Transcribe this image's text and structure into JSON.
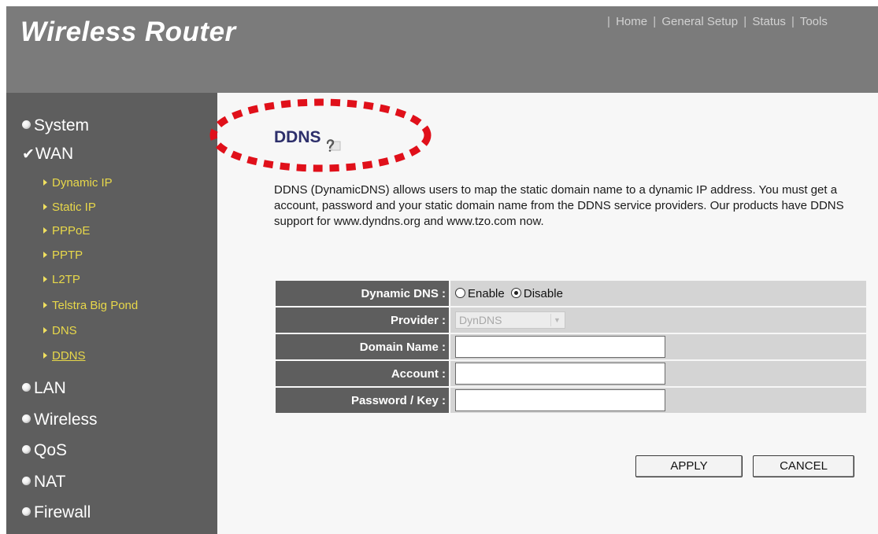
{
  "header": {
    "brand": "Wireless Router",
    "nav": [
      "Home",
      "General Setup",
      "Status",
      "Tools"
    ]
  },
  "sidebar": {
    "main_items": [
      "System",
      "WAN",
      "LAN",
      "Wireless",
      "QoS",
      "NAT",
      "Firewall"
    ],
    "wan_sub_items": [
      "Dynamic IP",
      "Static IP",
      "PPPoE",
      "PPTP",
      "L2TP",
      "Telstra Big Pond",
      "DNS",
      "DDNS"
    ],
    "active_main": "WAN",
    "active_sub": "DDNS"
  },
  "page": {
    "title": "DDNS",
    "description": "DDNS (DynamicDNS) allows users to map the static domain name to a dynamic IP address. You must get a account, password and your static domain name from the DDNS service providers. Our products have DDNS support for www.dyndns.org and www.tzo.com now."
  },
  "form": {
    "dynamic_dns_label": "Dynamic DNS :",
    "enable_label": "Enable",
    "disable_label": "Disable",
    "dynamic_dns_value": "Disable",
    "provider_label": "Provider :",
    "provider_value": "DynDNS",
    "domain_label": "Domain Name :",
    "domain_value": "",
    "account_label": "Account :",
    "account_value": "",
    "password_label": "Password / Key :",
    "password_value": ""
  },
  "buttons": {
    "apply": "APPLY",
    "cancel": "CANCEL"
  },
  "colors": {
    "header_bg": "#7b7b7b",
    "sidebar_bg": "#5e5e5e",
    "submenu_text": "#e8d84a",
    "title_text": "#2d2f6b",
    "highlight_oval": "#e0101a"
  }
}
